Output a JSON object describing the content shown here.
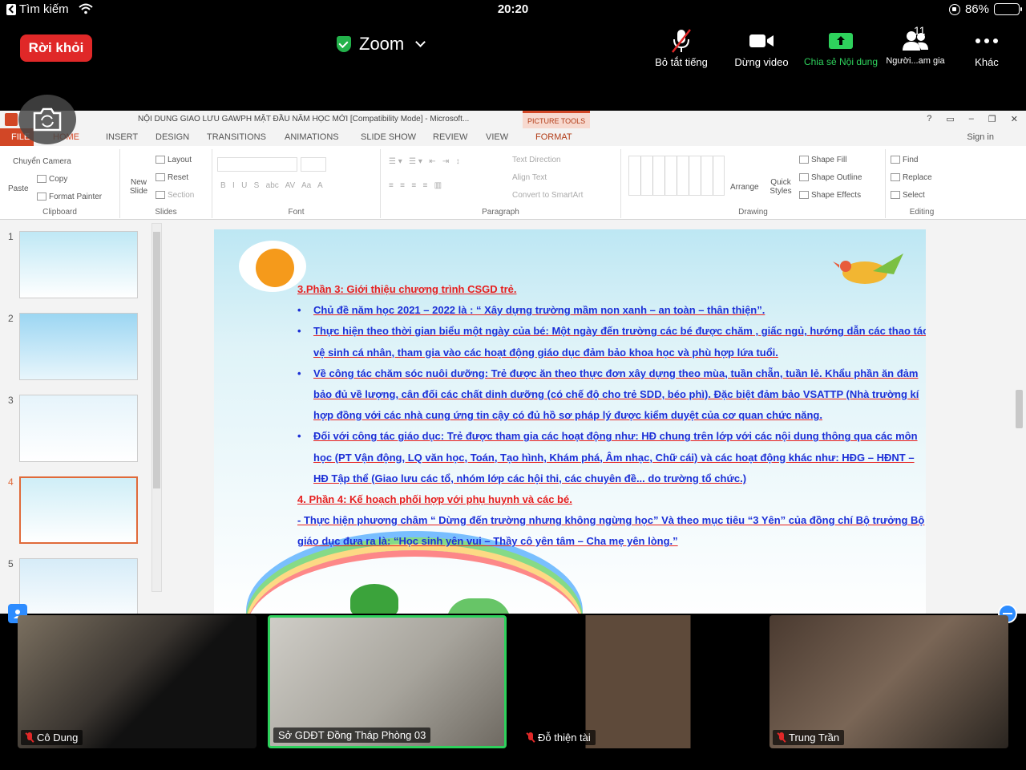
{
  "statusbar": {
    "back_label": "Tìm kiếm",
    "time": "20:20",
    "battery_text": "86%",
    "battery_level": 0.86
  },
  "topbar": {
    "leave_label": "Rời khỏi",
    "meeting_title": "Zoom",
    "tools": {
      "mute_all": "Bỏ tắt tiếng",
      "stop_video": "Dừng video",
      "share": "Chia sẻ Nội dung",
      "participants": "Người...am gia",
      "participants_count": "11",
      "more": "Khác"
    },
    "colors": {
      "leave": "#e02828",
      "share": "#2ed15c",
      "secure": "#23b24b"
    }
  },
  "powerpoint": {
    "doc_title": "NỘI DUNG GIAO LƯU GAWPH MẶT ĐẦU NĂM HỌC MỚI [Compatibility Mode] - Microsoft...",
    "picture_tools": "PICTURE TOOLS",
    "tabs": [
      "FILE",
      "HOME",
      "INSERT",
      "DESIGN",
      "TRANSITIONS",
      "ANIMATIONS",
      "SLIDE SHOW",
      "REVIEW",
      "VIEW",
      "FORMAT"
    ],
    "sign_in": "Sign in",
    "window_help": "?",
    "ribbon": {
      "clipboard": {
        "name": "Clipboard",
        "paste": "Paste",
        "cut": "Chuyển Camera",
        "copy": "Copy",
        "format_painter": "Format Painter"
      },
      "slides": {
        "name": "Slides",
        "new_slide": "New Slide",
        "layout": "Layout",
        "reset": "Reset",
        "section": "Section"
      },
      "font": {
        "name": "Font"
      },
      "paragraph": {
        "name": "Paragraph",
        "text_direction": "Text Direction",
        "align_text": "Align Text",
        "smartart": "Convert to SmartArt"
      },
      "drawing": {
        "name": "Drawing",
        "arrange": "Arrange",
        "quick_styles": "Quick Styles",
        "shape_fill": "Shape Fill",
        "shape_outline": "Shape Outline",
        "shape_effects": "Shape Effects"
      },
      "editing": {
        "name": "Editing",
        "find": "Find",
        "replace": "Replace",
        "select": "Select"
      }
    },
    "thumb_numbers": [
      "1",
      "2",
      "3",
      "4",
      "5"
    ],
    "slide": {
      "heading": "3.Phần 3: Giới thiệu chương trình CSGD trẻ.",
      "bullets": [
        "Chủ đề năm học 2021 – 2022 là : “ Xây dựng trường mầm non xanh – an toàn – thân thiện”.",
        "Thực hiện theo thời gian biểu một ngày của bé: Một ngày đến trường các bé được chăm , giấc ngủ, hướng dẫn các thao tác vệ sinh cá nhân, tham gia vào các hoạt động giáo dục đảm bảo khoa học và phù hợp lứa tuổi.",
        "Về công tác chăm sóc nuôi dưỡng: Trẻ được ăn theo thực đơn xây dựng theo mùa, tuần chẵn, tuần lẻ. Khẩu phần ăn đảm bảo đủ về lượng, cân đối các chất dinh dưỡng (có chế độ cho trẻ SDD, béo phì). Đặc biệt đảm bảo VSATTP (Nhà trường kí hợp đồng với các nhà cung ứng tin cậy có đủ hồ sơ pháp lý được kiểm duyệt của cơ quan chức năng.",
        "Đối với công tác giáo dục: Trẻ được tham gia các hoạt động như: HĐ chung trên lớp với các nội dung thông qua các môn học (PT Vận động, LQ văn học, Toán, Tạo hình, Khám phá, Âm nhạc, Chữ cái) và các hoạt động khác như: HĐG – HĐNT – HĐ Tập thể (Giao lưu các tổ, nhóm lớp các hội thi, các chuyên đề... do trường tổ chức.)"
      ],
      "heading2": "4. Phần 4: Kế hoạch phối hợp với phụ huynh và các bé.",
      "closing": "- Thực hiện phương châm “ Dừng đến trường nhưng không ngừng học” Và theo mục tiêu “3 Yên” của đồng chí Bộ trưởng Bộ giáo dục đưa ra là: “Học sinh yên vui – Thầy cô yên tâm – Cha mẹ yên lòng.”"
    }
  },
  "participants": [
    {
      "name": "Cô Dung",
      "muted": true,
      "active": false
    },
    {
      "name": "Sở GDĐT Đồng Tháp Phòng 03",
      "muted": false,
      "active": true
    },
    {
      "name": "Đỗ thiện tài",
      "muted": true,
      "active": false
    },
    {
      "name": "Trung Trần",
      "muted": true,
      "active": false
    }
  ]
}
